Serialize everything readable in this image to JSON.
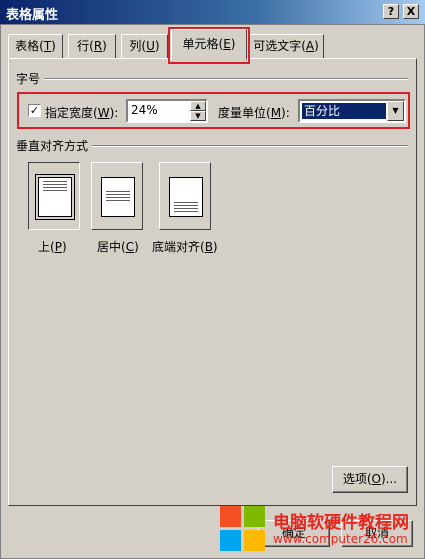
{
  "window": {
    "title": "表格属性",
    "help_button": "?",
    "close_button": "X"
  },
  "tabs": [
    {
      "label": "表格(",
      "mnemonic": "T",
      "suffix": ")"
    },
    {
      "label": "行(",
      "mnemonic": "R",
      "suffix": ")"
    },
    {
      "label": "列(",
      "mnemonic": "U",
      "suffix": ")"
    },
    {
      "label": "单元格(",
      "mnemonic": "E",
      "suffix": ")",
      "active": true
    },
    {
      "label": "可选文字(",
      "mnemonic": "A",
      "suffix": ")"
    }
  ],
  "size_section": {
    "title": "字号",
    "checkbox_checked": true,
    "checkbox_mark": "✓",
    "width_label": "指定宽度(",
    "width_mnemonic": "W",
    "width_suffix": "):",
    "width_value": "24%",
    "unit_label": "度量单位(",
    "unit_mnemonic": "M",
    "unit_suffix": "):",
    "unit_value": "百分比"
  },
  "valign_section": {
    "title": "垂直对齐方式",
    "options": [
      {
        "label": "上(",
        "mnemonic": "P",
        "suffix": ")",
        "selected": true
      },
      {
        "label": "居中(",
        "mnemonic": "C",
        "suffix": ")"
      },
      {
        "label": "底端对齐(",
        "mnemonic": "B",
        "suffix": ")"
      }
    ]
  },
  "buttons": {
    "options": {
      "label": "选项(",
      "mnemonic": "O",
      "suffix": ")..."
    },
    "ok": "确定",
    "cancel": "取消"
  },
  "watermark": {
    "line1": "电脑软硬件教程网",
    "line2": "www.computer26.com"
  },
  "colors": {
    "highlight_red": "#d91f2a",
    "selection_blue": "#0a246a",
    "dialog_gray": "#d4d0c8"
  }
}
